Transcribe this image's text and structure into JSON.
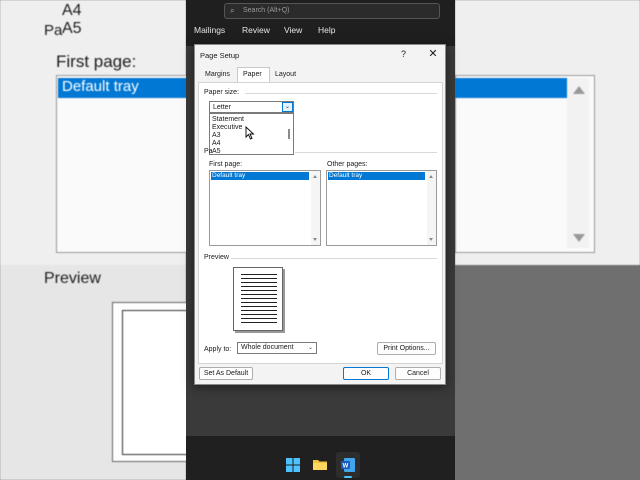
{
  "background": {
    "left_list_items": [
      "A4",
      "A5"
    ],
    "left_first_page_label": "First page:",
    "left_selected_tray": "Default tray",
    "left_preview_label": "Preview",
    "left_cut_label": "Pa"
  },
  "ribbon": {
    "search_placeholder": "Search (Alt+Q)",
    "menus": [
      "Mailings",
      "Review",
      "View",
      "Help"
    ]
  },
  "dialog": {
    "title": "Page Setup",
    "help_glyph": "?",
    "close_glyph": "✕",
    "tabs": [
      "Margins",
      "Paper",
      "Layout"
    ],
    "active_tab": "Paper",
    "paper_size_label": "Paper size:",
    "paper_size_value": "Letter",
    "paper_size_options": [
      "Statement",
      "Executive",
      "A3",
      "A4",
      "A5"
    ],
    "paper_source_cut": "Pa",
    "first_page_label": "First page:",
    "first_page_selected": "Default tray",
    "other_pages_label": "Other pages:",
    "other_pages_selected": "Default tray",
    "preview_label": "Preview",
    "apply_to_label": "Apply to:",
    "apply_to_value": "Whole document",
    "print_options_button": "Print Options...",
    "set_default_button": "Set As Default",
    "ok_button": "OK",
    "cancel_button": "Cancel"
  },
  "colors": {
    "accent": "#0078d4",
    "dialog_bg": "#f3f3f3",
    "dark_bg": "#202020"
  }
}
